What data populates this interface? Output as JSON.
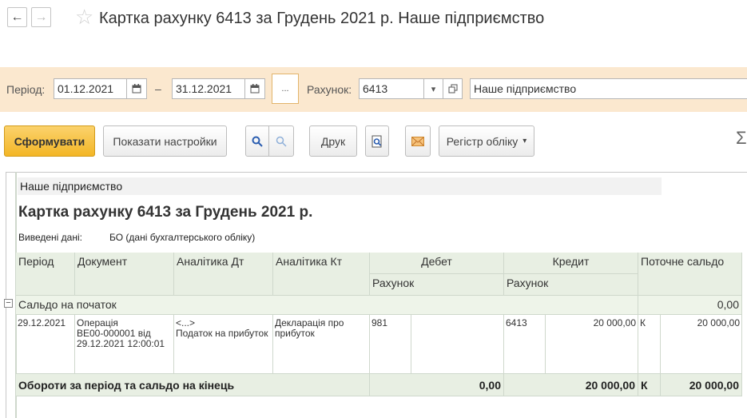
{
  "window": {
    "title": "Картка рахунку 6413 за Грудень 2021 р. Наше підприємство",
    "back_icon": "arrow-left-icon",
    "forward_icon": "arrow-right-icon",
    "favorite_icon": "star-icon"
  },
  "filters": {
    "period_label": "Період:",
    "date_from": "01.12.2021",
    "dash": "–",
    "date_to": "31.12.2021",
    "period_picker": "...",
    "account_label": "Рахунок:",
    "account_value": "6413",
    "organization": "Наше підприємство"
  },
  "toolbar": {
    "generate": "Сформувати",
    "show_settings": "Показати настройки",
    "print": "Друк",
    "register": "Регістр обліку",
    "sigma": "Σ"
  },
  "report": {
    "organization": "Наше підприємство",
    "title": "Картка рахунку 6413 за Грудень 2021 р.",
    "data_label": "Виведені дані:",
    "data_value": "БО (дані бухгалтерського обліку)",
    "columns": {
      "period": "Період",
      "document": "Документ",
      "analytics_dt": "Аналітика Дт",
      "analytics_kt": "Аналітика Кт",
      "debit": "Дебет",
      "credit": "Кредит",
      "balance": "Поточне сальдо",
      "debit_account": "Рахунок",
      "credit_account": "Рахунок"
    },
    "opening": {
      "label": "Сальдо на початок",
      "value": "0,00",
      "toggle": "−"
    },
    "rows": [
      {
        "date": "29.12.2021",
        "document": [
          "Операція",
          "BE00-000001 від",
          "29.12.2021 12:00:01"
        ],
        "analytics_dt": [
          "<...>",
          "Податок на прибуток"
        ],
        "analytics_kt": [
          "Декларація про",
          "прибуток"
        ],
        "debit_account": "981",
        "debit_amount": "",
        "credit_account": "6413",
        "credit_amount": "20 000,00",
        "balance_side": "К",
        "balance_amount": "20 000,00"
      }
    ],
    "totals": {
      "label": "Обороти за період та сальдо на кінець",
      "debit": "0,00",
      "credit": "20 000,00",
      "side": "К",
      "balance": "20 000,00"
    }
  }
}
